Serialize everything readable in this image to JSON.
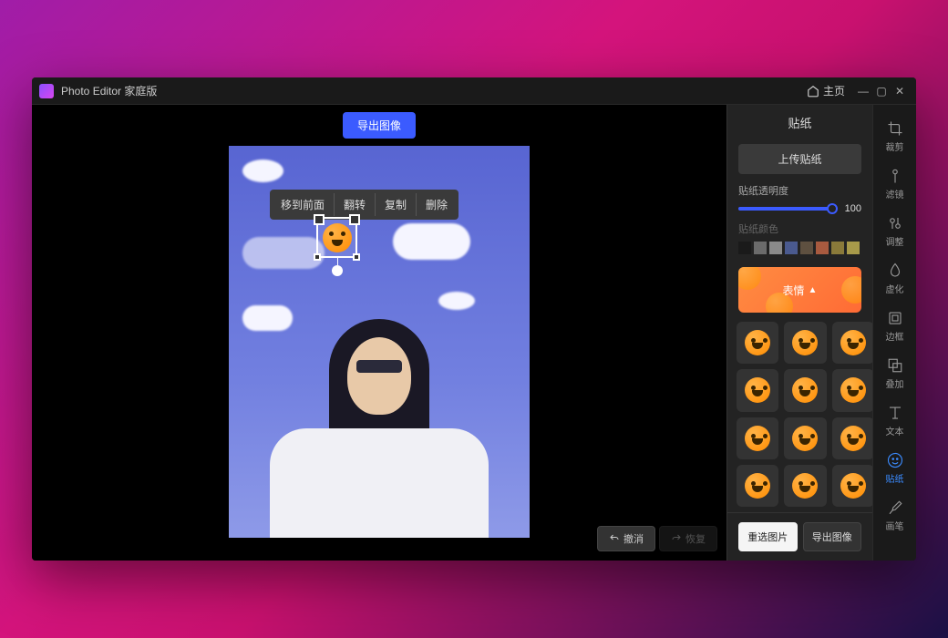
{
  "app": {
    "title": "Photo Editor 家庭版",
    "home_label": "主页"
  },
  "canvas": {
    "export_label": "导出图像",
    "context_actions": [
      "移到前面",
      "翻转",
      "复制",
      "删除"
    ],
    "undo_label": "撤消",
    "redo_label": "恢复"
  },
  "panel": {
    "title": "贴纸",
    "upload_label": "上传贴纸",
    "opacity_label": "贴纸透明度",
    "opacity_value": "100",
    "color_label": "贴纸颜色",
    "swatches": [
      "#1a1a1a",
      "#6b6b6b",
      "#8a8a8a",
      "#4a5a8f",
      "#5e5040",
      "#a85a3f",
      "#8a7a3a",
      "#a89a4a"
    ],
    "category_label": "表情",
    "reselect_label": "重选图片",
    "export_label": "导出图像"
  },
  "tools": [
    {
      "id": "crop",
      "label": "裁剪"
    },
    {
      "id": "filter",
      "label": "滤镜"
    },
    {
      "id": "adjust",
      "label": "调整"
    },
    {
      "id": "blur",
      "label": "虚化"
    },
    {
      "id": "frame",
      "label": "边框"
    },
    {
      "id": "overlay",
      "label": "叠加"
    },
    {
      "id": "text",
      "label": "文本"
    },
    {
      "id": "sticker",
      "label": "贴纸",
      "active": true
    },
    {
      "id": "brush",
      "label": "画笔"
    }
  ]
}
